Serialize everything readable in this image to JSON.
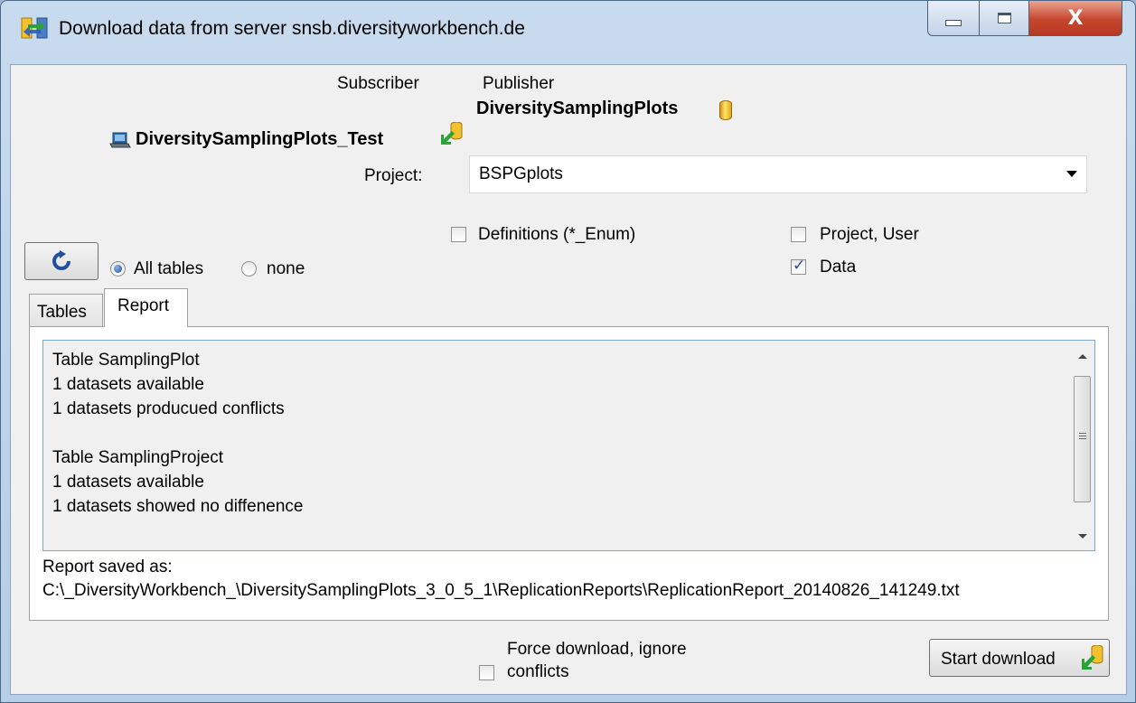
{
  "window": {
    "title": "Download data from server snsb.diversityworkbench.de",
    "close_symbol": "X"
  },
  "header": {
    "subscriber_label": "Subscriber",
    "publisher_label": "Publisher",
    "subscriber_db": "DiversitySamplingPlots_Test",
    "publisher_db": "DiversitySamplingPlots"
  },
  "project": {
    "label": "Project:",
    "value": "BSPGplots"
  },
  "options": {
    "definitions_label": "Definitions (*_Enum)",
    "definitions_checked": false,
    "project_user_label": "Project, User",
    "project_user_checked": false,
    "data_label": "Data",
    "data_checked": true
  },
  "selection": {
    "all_tables_label": "All tables",
    "none_label": "none",
    "selected": "All tables"
  },
  "tabs": [
    {
      "label": "Tables",
      "active": false
    },
    {
      "label": "Report",
      "active": true
    }
  ],
  "report": {
    "text": "Table SamplingPlot\n1 datasets available\n1 datasets producued conflicts\n\nTable SamplingProject\n1 datasets available\n1 datasets showed no diffenence",
    "saved_label": "Report saved as:",
    "saved_path": "C:\\_DiversityWorkbench_\\DiversitySamplingPlots_3_0_5_1\\ReplicationReports\\ReplicationReport_20140826_141249.txt"
  },
  "footer": {
    "force_label_line1": "Force download, ignore",
    "force_label_line2": "conflicts",
    "force_checked": false,
    "start_button": "Start download"
  }
}
